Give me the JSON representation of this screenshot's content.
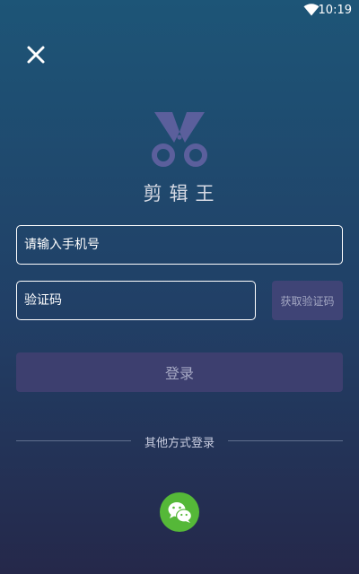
{
  "status_bar": {
    "time": "10:19",
    "wifi_icon": "wifi-icon"
  },
  "header": {
    "close_icon": "close-icon"
  },
  "logo": {
    "icon": "scissors-icon",
    "app_name": "剪辑王"
  },
  "form": {
    "phone_placeholder": "请输入手机号",
    "phone_value": "",
    "code_placeholder": "验证码",
    "code_value": "",
    "get_code_label": "获取验证码",
    "login_label": "登录"
  },
  "alt_login": {
    "label": "其他方式登录",
    "wechat_icon": "wechat-icon"
  },
  "colors": {
    "background_top": "#1d5577",
    "background_bottom": "#25284a",
    "logo": "#5b5f9c",
    "button": "#3d3f6f",
    "wechat": "#55b838"
  }
}
